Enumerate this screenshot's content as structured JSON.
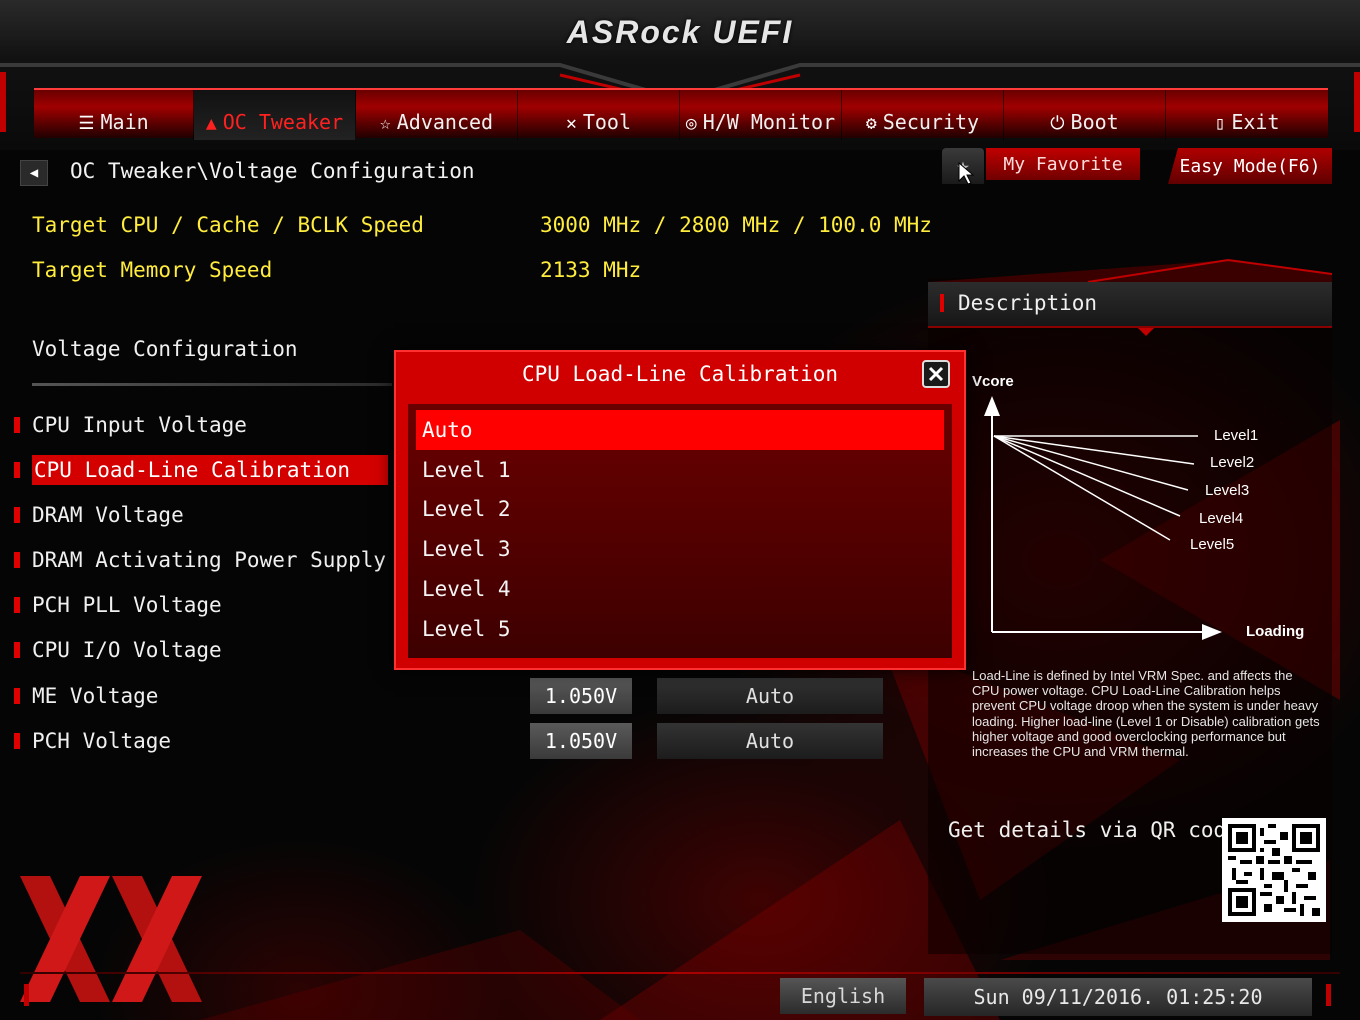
{
  "brand": "ASRock UEFI",
  "tabs": [
    {
      "label": "Main",
      "icon": "list-icon",
      "active": false
    },
    {
      "label": "OC Tweaker",
      "icon": "flame-icon",
      "active": true
    },
    {
      "label": "Advanced",
      "icon": "star-advanced-icon",
      "active": false
    },
    {
      "label": "Tool",
      "icon": "tools-icon",
      "active": false
    },
    {
      "label": "H/W Monitor",
      "icon": "monitor-icon",
      "active": false
    },
    {
      "label": "Security",
      "icon": "shield-icon",
      "active": false
    },
    {
      "label": "Boot",
      "icon": "power-icon",
      "active": false
    },
    {
      "label": "Exit",
      "icon": "exit-icon",
      "active": false
    }
  ],
  "breadcrumb": "OC Tweaker\\Voltage Configuration",
  "favorites": {
    "my_favorite": "My Favorite",
    "easy_mode": "Easy Mode(F6)"
  },
  "targets": {
    "cpu_label": "Target CPU / Cache / BCLK Speed",
    "cpu_value": "3000 MHz / 2800 MHz / 100.0 MHz",
    "mem_label": "Target Memory Speed",
    "mem_value": "2133 MHz"
  },
  "section_title": "Voltage Configuration",
  "settings": [
    {
      "label": "CPU Input Voltage"
    },
    {
      "label": "CPU Load-Line Calibration"
    },
    {
      "label": "DRAM Voltage"
    },
    {
      "label": "DRAM Activating Power Supply"
    },
    {
      "label": "PCH PLL Voltage"
    },
    {
      "label": "CPU I/O Voltage"
    },
    {
      "label": "ME Voltage",
      "value": "1.050V",
      "mode": "Auto"
    },
    {
      "label": "PCH Voltage",
      "value": "1.050V",
      "mode": "Auto"
    }
  ],
  "modal": {
    "title": "CPU Load-Line Calibration",
    "options": [
      "Auto",
      "Level 1",
      "Level 2",
      "Level 3",
      "Level 4",
      "Level 5"
    ],
    "selected_index": 0
  },
  "description": {
    "title": "Description",
    "graph": {
      "y_label": "Vcore",
      "x_label": "Loading",
      "levels": [
        "Level1",
        "Level2",
        "Level3",
        "Level4",
        "Level5"
      ]
    },
    "text": "Load-Line is defined by Intel VRM Spec. and affects the CPU power voltage. CPU Load-Line Calibration helps prevent CPU voltage droop when the system is under heavy loading. Higher load-line (Level 1 or Disable) calibration gets higher voltage and good overclocking performance but increases the CPU and VRM thermal.",
    "qr_label": "Get details via QR code"
  },
  "footer": {
    "language": "English",
    "datetime": "Sun 09/11/2016. 01:25:20"
  },
  "colors": {
    "accent": "#d00000",
    "highlight": "#ff0000",
    "info_text": "#ffec3d"
  }
}
